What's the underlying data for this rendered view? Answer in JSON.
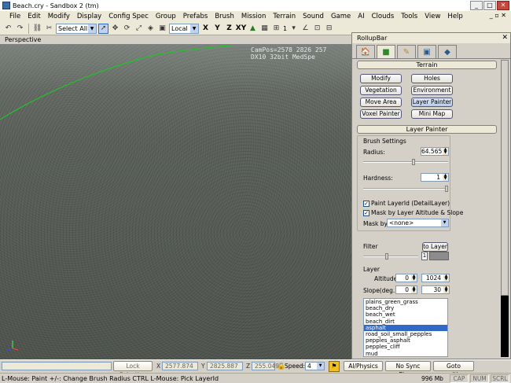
{
  "window": {
    "title": "Beach.cry - Sandbox 2 (tm)",
    "btn_min": "_",
    "btn_max": "□",
    "btn_close": "✕"
  },
  "menubar": {
    "items": [
      "File",
      "Edit",
      "Modify",
      "Display",
      "Config Spec",
      "Group",
      "Prefabs",
      "Brush",
      "Mission",
      "Terrain",
      "Sound",
      "Game",
      "AI",
      "Clouds",
      "Tools",
      "View",
      "Help"
    ],
    "mdi_controls": "_ ▫ ✕"
  },
  "toolbar": {
    "selection_filter": "Select All",
    "coord_system": "Local",
    "axis_labels": [
      "X",
      "Y",
      "Z",
      "XY"
    ],
    "layer_count": "1"
  },
  "viewport": {
    "name": "Perspective",
    "campos_line1": "CamPos=2578 2826 257",
    "campos_line2": "DX10 32bit MedSpe"
  },
  "rollup": {
    "title": "RollupBar",
    "close": "✕",
    "terrain_header": "Terrain",
    "tools": [
      "Modify",
      "Holes",
      "Vegetation",
      "Environment",
      "Move Area",
      "Layer Painter",
      "Voxel Painter",
      "Mini Map"
    ],
    "active_tool": "Layer Painter",
    "painter_header": "Layer Painter",
    "brush_settings": "Brush Settings",
    "radius_label": "Radius:",
    "radius_value": "64.565",
    "hardness_label": "Hardness:",
    "hardness_value": "1",
    "paint_layer_label": "Paint LayerId (DetailLayer)",
    "mask_altitude_label": "Mask by Layer Altitude & Slope",
    "mask_by_label": "Mask by",
    "mask_by_value": "<none>",
    "filter_label": "Filter",
    "to_layer_label": "to Layer",
    "filter_value": "1",
    "layer_label": "Layer",
    "altitude_label": "Altitude",
    "altitude_min": "0",
    "altitude_max": "1024",
    "slope_label": "Slope(deg.)",
    "slope_min": "0",
    "slope_max": "30",
    "layers": [
      "plains_green_grass",
      "beach_dry",
      "beach_wet",
      "beach_dirt",
      "asphalt",
      "road_soil_small_pepples",
      "pepples_asphalt",
      "pepples_cliff",
      "mud"
    ],
    "selected_layer": "asphalt"
  },
  "ctrlbar": {
    "lock_selection": "Lock Selection",
    "x_label": "X",
    "x_value": "2577.874",
    "y_label": "Y",
    "y_value": "2825.887",
    "z_label": "Z",
    "z_value": "255.0495",
    "speed_label": "Speed:",
    "speed_value": "4",
    "ai_physics": "AI/Physics",
    "no_sync_player": "No Sync Player",
    "goto_position": "Goto position"
  },
  "statusbar": {
    "hint": "L-Mouse: Paint   +/-: Change Brush Radius   CTRL L-Mouse: Pick LayerId",
    "memory": "996 Mb",
    "cap": "CAP",
    "num": "NUM",
    "scrl": "SCRL"
  },
  "colors": {
    "accent": "#3169c6",
    "spline": "#22c22a",
    "panel": "#d4d0c8"
  }
}
